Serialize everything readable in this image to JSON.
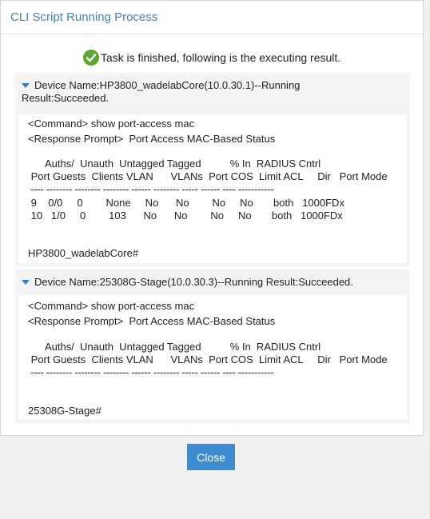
{
  "dialog": {
    "title": "CLI Script Running Process",
    "status": "Task is finished, following is the executing result.",
    "close_label": "Close"
  },
  "devices": [
    {
      "title_line1": "Device Name:HP3800_wadelabCore(10.0.30.1)--Running",
      "title_line2": "Result:Succeeded.",
      "command": "<Command> show port-access mac",
      "response": "<Response Prompt>  Port Access MAC-Based Status",
      "header1": "      Auths/  Unauth  Untagged Tagged          % In  RADIUS Cntrl",
      "header2": " Port Guests  Clients VLAN      VLANs  Port COS  Limit ACL     Dir   Port Mode",
      "separator": " ---- -------- -------- -------- ------ -------- ----- ------ ---- -----------",
      "rows": [
        " 9    0/0     0        None     No      No        No     No       both   1000FDx",
        " 10   1/0     0        103      No      No        No     No       both   1000FDx"
      ],
      "prompt": "HP3800_wadelabCore#"
    },
    {
      "title_line1": "Device Name:25308G-Stage(10.0.30.3)--Running Result:Succeeded.",
      "title_line2": "",
      "command": "<Command> show port-access mac",
      "response": "<Response Prompt>  Port Access MAC-Based Status",
      "header1": "      Auths/  Unauth  Untagged Tagged          % In  RADIUS Cntrl",
      "header2": " Port Guests  Clients VLAN      VLANs  Port COS  Limit ACL     Dir   Port Mode",
      "separator": " ---- -------- -------- -------- ------ -------- ----- ------ ---- -----------",
      "rows": [],
      "prompt": "25308G-Stage#"
    }
  ]
}
